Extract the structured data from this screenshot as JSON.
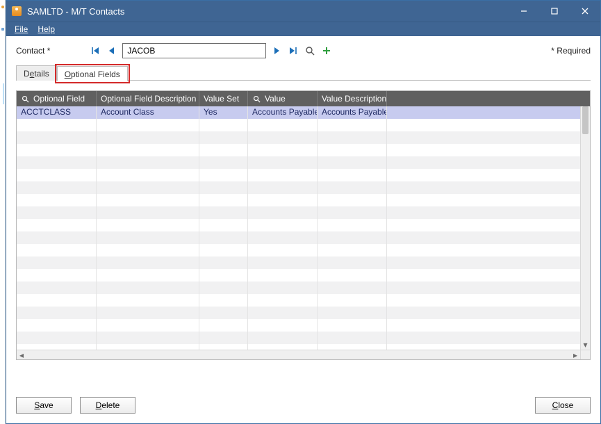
{
  "window": {
    "title": "SAMLTD - M/T Contacts"
  },
  "menu": {
    "file": "File",
    "help": "Help"
  },
  "toolbar": {
    "contact_label": "Contact *",
    "contact_value": "JACOB",
    "required_label": "* Required"
  },
  "tabs": {
    "details": "Details",
    "optional_fields": "Optional Fields"
  },
  "grid": {
    "headers": {
      "optional_field": "Optional Field",
      "optional_field_desc": "Optional Field Description",
      "value_set": "Value Set",
      "value": "Value",
      "value_desc": "Value Description"
    },
    "rows": [
      {
        "field": "ACCTCLASS",
        "desc": "Account Class",
        "value_set": "Yes",
        "value": "Accounts Payable",
        "value_desc": "Accounts Payable"
      }
    ]
  },
  "footer": {
    "save": "Save",
    "delete": "Delete",
    "close": "Close"
  }
}
